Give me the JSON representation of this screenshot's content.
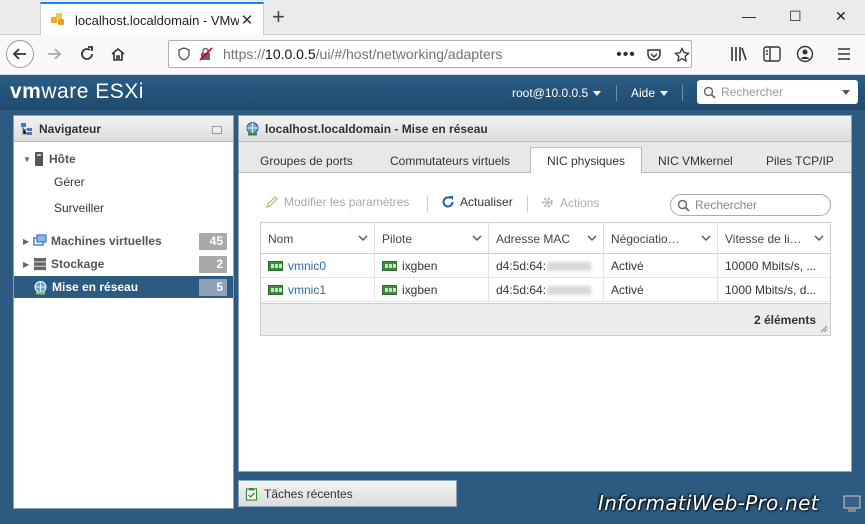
{
  "browser": {
    "tab_title": "localhost.localdomain - VMware",
    "tab_close": "✕",
    "new_tab": "+",
    "url_prefix": "https://",
    "url_host": "10.0.0.5",
    "url_path": "/ui/#/host/networking/adapters",
    "window_controls": [
      "—",
      "☐",
      "✕"
    ]
  },
  "header": {
    "brand_vm": "vm",
    "brand_rest": "ware ESXi",
    "user": "root@10.0.0.5",
    "help": "Aide",
    "search_placeholder": "Rechercher"
  },
  "navigator": {
    "title": "Navigateur",
    "host": "Hôte",
    "host_children": [
      "Gérer",
      "Surveiller"
    ],
    "items": [
      {
        "label": "Machines virtuelles",
        "count": "45"
      },
      {
        "label": "Stockage",
        "count": "2"
      },
      {
        "label": "Mise en réseau",
        "count": "5"
      }
    ]
  },
  "content": {
    "title": "localhost.localdomain - Mise en réseau",
    "tabs": [
      "Groupes de ports",
      "Commutateurs virtuels",
      "NIC physiques",
      "NIC VMkernel",
      "Piles TCP/IP"
    ],
    "active_tab": "NIC physiques",
    "toolbar": {
      "edit": "Modifier les paramètres",
      "refresh": "Actualiser",
      "actions": "Actions"
    },
    "search_placeholder": "Rechercher",
    "columns": [
      "Nom",
      "Pilote",
      "Adresse MAC",
      "Négociation auto",
      "Vitesse de liaison"
    ],
    "rows": [
      {
        "name": "vmnic0",
        "driver": "ixgben",
        "mac": "d4:5d:64:",
        "auto": "Activé",
        "speed": "10000 Mbits/s, ..."
      },
      {
        "name": "vmnic1",
        "driver": "ixgben",
        "mac": "d4:5d:64:",
        "auto": "Activé",
        "speed": "1000 Mbits/s, d..."
      }
    ],
    "count": "2 éléments"
  },
  "tasks": {
    "label": "Tâches récentes"
  },
  "watermark": "InformatiWeb-Pro.net"
}
